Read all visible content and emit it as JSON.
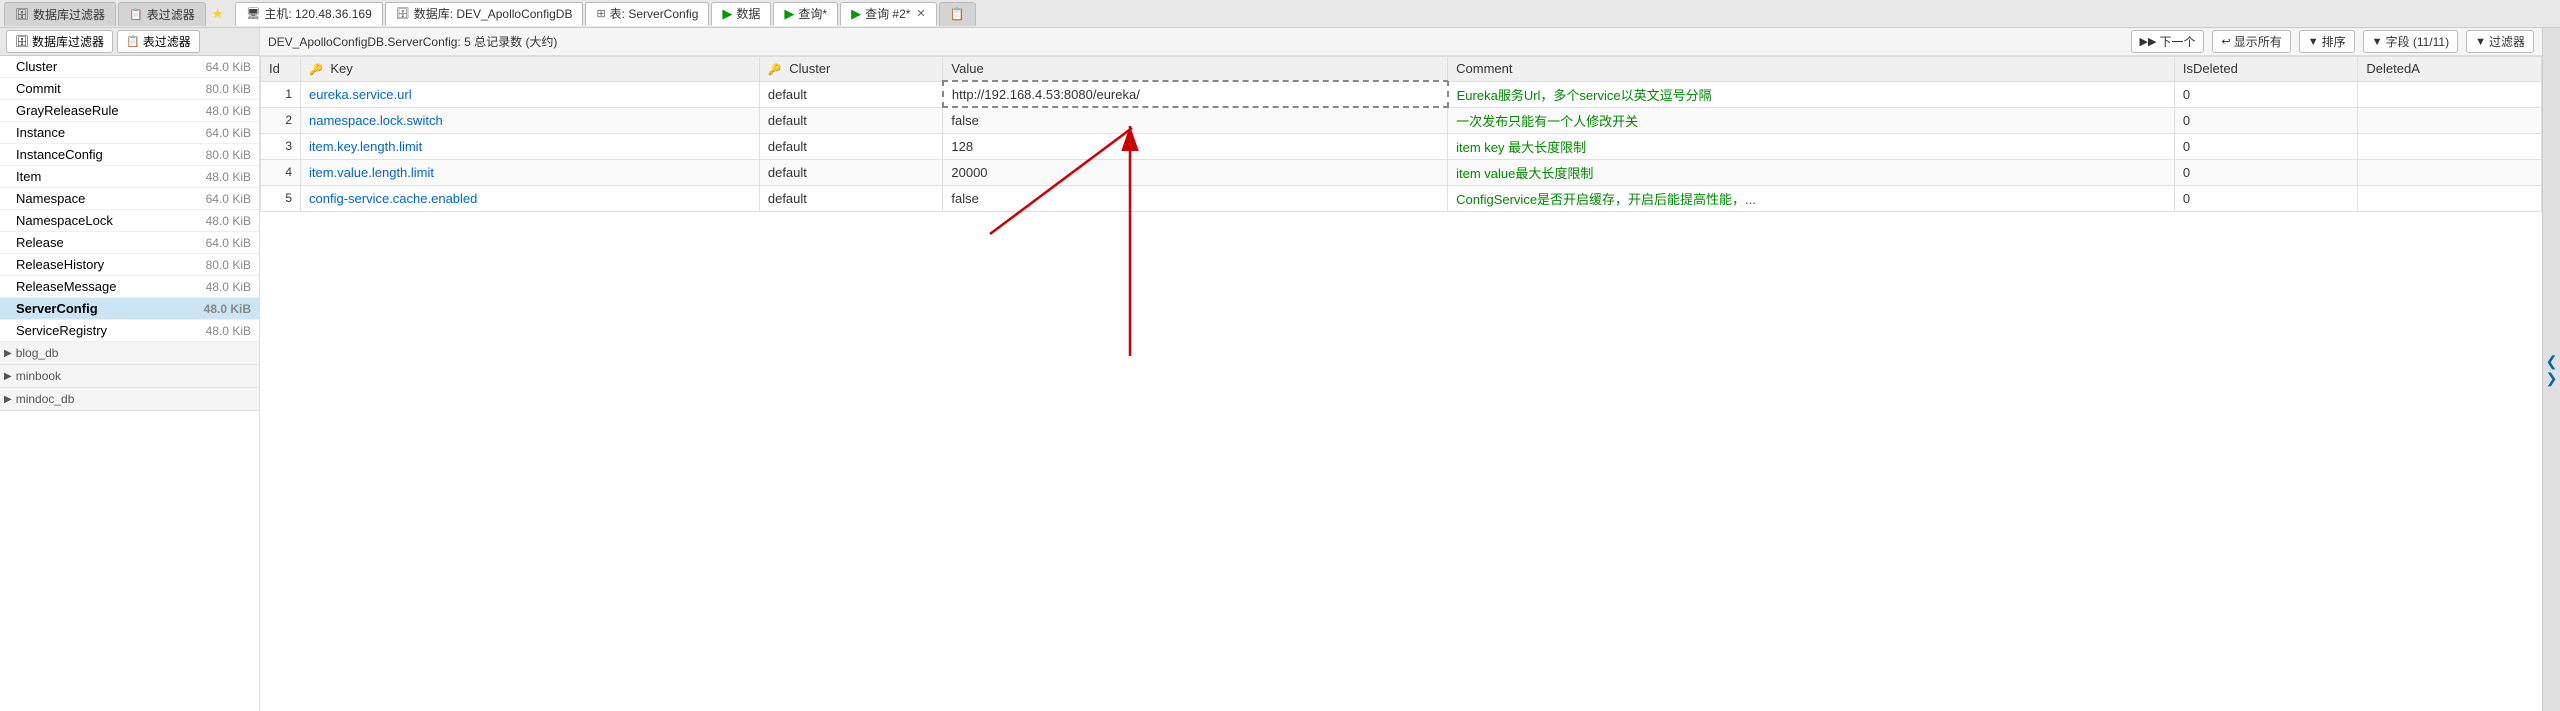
{
  "tabBar": {
    "tabs": [
      {
        "id": "db-filter",
        "icon": "🗄",
        "label": "数据库过滤器",
        "active": false,
        "closable": false
      },
      {
        "id": "table-filter",
        "icon": "📋",
        "label": "表过滤器",
        "active": false,
        "closable": false
      }
    ],
    "starIcon": "★",
    "hostLabel": "主机: 120.48.36.169",
    "dbLabel": "数据库: DEV_ApolloConfigDB",
    "tableLabel": "表: ServerConfig",
    "dataLabel": "数据",
    "queryLabel": "查询*",
    "query2Label": "查询 #2*",
    "closeIcon": "✕",
    "copyIcon": "📋"
  },
  "infoBar": {
    "text": "DEV_ApolloConfigDB.ServerConfig: 5 总记录数 (大约)",
    "nextBtn": "下一个",
    "showAllBtn": "显示所有",
    "sortBtn": "排序",
    "fieldsBtn": "字段 (11/11)",
    "filterBtn": "过滤器"
  },
  "sidebar": {
    "dbFilterLabel": "数据库过滤器",
    "tableFilterLabel": "表过滤器",
    "items": [
      {
        "name": "Cluster",
        "size": "64.0 KiB",
        "selected": false
      },
      {
        "name": "Commit",
        "size": "80.0 KiB",
        "selected": false
      },
      {
        "name": "GrayReleaseRule",
        "size": "48.0 KiB",
        "selected": false
      },
      {
        "name": "Instance",
        "size": "64.0 KiB",
        "selected": false
      },
      {
        "name": "InstanceConfig",
        "size": "80.0 KiB",
        "selected": false
      },
      {
        "name": "Item",
        "size": "48.0 KiB",
        "selected": false
      },
      {
        "name": "Namespace",
        "size": "64.0 KiB",
        "selected": false
      },
      {
        "name": "NamespaceLock",
        "size": "48.0 KiB",
        "selected": false
      },
      {
        "name": "Release",
        "size": "64.0 KiB",
        "selected": false
      },
      {
        "name": "ReleaseHistory",
        "size": "80.0 KiB",
        "selected": false
      },
      {
        "name": "ReleaseMessage",
        "size": "48.0 KiB",
        "selected": false
      },
      {
        "name": "ServerConfig",
        "size": "48.0 KiB",
        "selected": true
      },
      {
        "name": "ServiceRegistry",
        "size": "48.0 KiB",
        "selected": false
      }
    ],
    "groups": [
      {
        "name": "blog_db",
        "expanded": false
      },
      {
        "name": "minbook",
        "expanded": false
      },
      {
        "name": "mindoc_db",
        "expanded": false
      }
    ]
  },
  "table": {
    "columns": [
      "Id",
      "Key",
      "Cluster",
      "Value",
      "Comment",
      "IsDeleted",
      "DeletedA"
    ],
    "keyColIcon": "🔑",
    "fkColIcon": "🔑",
    "rows": [
      {
        "id": "1",
        "key": "eureka.service.url",
        "cluster": "default",
        "value": "http://192.168.4.53:8080/eureka/",
        "comment": "Eureka服务Url，多个service以英文逗号分隔",
        "isDeleted": "0",
        "deletedA": ""
      },
      {
        "id": "2",
        "key": "namespace.lock.switch",
        "cluster": "default",
        "value": "false",
        "comment": "一次发布只能有一个人修改开关",
        "isDeleted": "0",
        "deletedA": ""
      },
      {
        "id": "3",
        "key": "item.key.length.limit",
        "cluster": "default",
        "value": "128",
        "comment": "item key 最大长度限制",
        "isDeleted": "0",
        "deletedA": ""
      },
      {
        "id": "4",
        "key": "item.value.length.limit",
        "cluster": "default",
        "value": "20000",
        "comment": "item value最大长度限制",
        "isDeleted": "0",
        "deletedA": ""
      },
      {
        "id": "5",
        "key": "config-service.cache.enabled",
        "cluster": "default",
        "value": "false",
        "comment": "ConfigService是否开启缓存，开启后能提高性能，...",
        "isDeleted": "0",
        "deletedA": ""
      }
    ]
  },
  "arrow": {
    "description": "Red arrow pointing from row 2 value area upward"
  }
}
